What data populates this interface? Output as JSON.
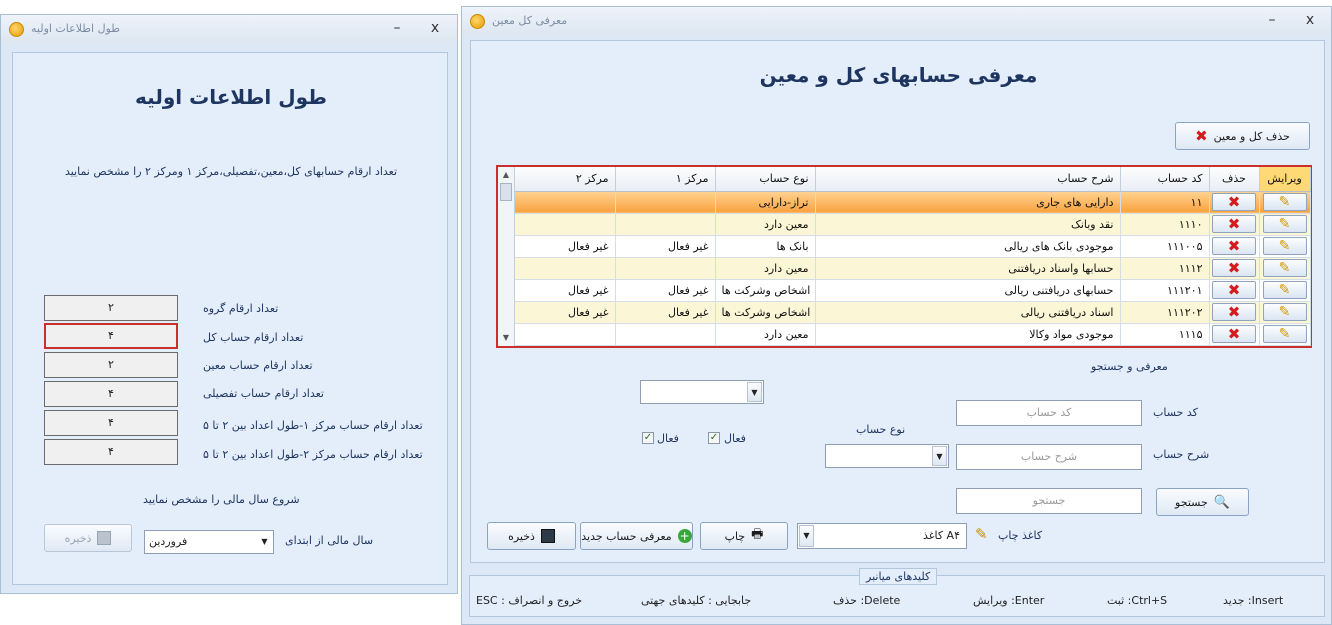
{
  "left_window": {
    "title": "طول اطلاعات اولیه",
    "close": "x",
    "minimize": "–",
    "heading": "طول اطلاعات اولیه",
    "instruction": "تعداد ارقام حسابهای کل،معین،تفصیلی،مرکز ۱ ومرکز ۲ را مشخص نمایید",
    "fields": [
      {
        "label": "تعداد ارقام گروه",
        "value": "۲",
        "selected": false
      },
      {
        "label": "تعداد ارقام حساب کل",
        "value": "۴",
        "selected": true
      },
      {
        "label": "تعداد ارقام حساب معین",
        "value": "۲",
        "selected": false
      },
      {
        "label": "تعداد ارقام حساب تفصیلی",
        "value": "۴",
        "selected": false
      },
      {
        "label": "تعداد ارقام حساب مرکز ۱-طول اعداد بین ۲ تا ۵",
        "value": "۴",
        "selected": false
      },
      {
        "label": "تعداد ارقام حساب مرکز ۲-طول اعداد بین ۲ تا ۵",
        "value": "۴",
        "selected": false
      }
    ],
    "fiscal_heading": "شروع سال مالی را مشخص نمایید",
    "fiscal_label": "سال مالی از ابتدای",
    "fiscal_value": "فروردین",
    "save_label": "ذخیره"
  },
  "main_window": {
    "title": "معرفی کل معین",
    "close": "x",
    "minimize": "–",
    "heading": "معرفی حسابهای کل و معین",
    "delete_all_label": "حذف کل و معین",
    "grid": {
      "columns": [
        "ویرایش",
        "حذف",
        "کد حساب",
        "شرح حساب",
        "نوع حساب",
        "مرکز ۱",
        "مرکز ۲"
      ],
      "rows": [
        {
          "code": "۱۱",
          "desc": "دارایی های جاری",
          "type": "تراز-دارایی",
          "c1": "",
          "c2": "",
          "style": "sel"
        },
        {
          "code": "۱۱۱۰",
          "desc": "نقد وبانک",
          "type": "معین دارد",
          "c1": "",
          "c2": "",
          "style": "alt"
        },
        {
          "code": "۱۱۱۰۰۵",
          "desc": "موجودی بانک های ریالی",
          "type": "بانک ها",
          "c1": "غیر فعال",
          "c2": "غیر فعال",
          "style": ""
        },
        {
          "code": "۱۱۱۲",
          "desc": "حسابها واسناد دریافتنی",
          "type": "معین دارد",
          "c1": "",
          "c2": "",
          "style": "alt"
        },
        {
          "code": "۱۱۱۲۰۱",
          "desc": "حسابهای دریافتنی ریالی",
          "type": "اشخاص وشرکت ها",
          "c1": "غیر فعال",
          "c2": "غیر فعال",
          "style": ""
        },
        {
          "code": "۱۱۱۲۰۲",
          "desc": "اسناد دریافتنی ریالی",
          "type": "اشخاص وشرکت ها",
          "c1": "غیر فعال",
          "c2": "غیر فعال",
          "style": "alt"
        },
        {
          "code": "۱۱۱۵",
          "desc": "موجودی مواد وکالا",
          "type": "معین دارد",
          "c1": "",
          "c2": "",
          "style": ""
        }
      ]
    },
    "search_section": "معرفی و جستجو",
    "code_label": "کد حساب",
    "code_placeholder": "کد حساب",
    "desc_label": "شرح حساب",
    "desc_placeholder": "شرح حساب",
    "search_placeholder": "جستجو",
    "search_button": "جستجو",
    "account_type_label": "نوع حساب",
    "active1_label": "فعال",
    "active2_label": "فعال",
    "print_paper_label": "کاغذ چاپ",
    "print_paper_value": "کاغذ A۴",
    "print_button": "چاپ",
    "new_account_button": "معرفی حساب جدید",
    "save_button": "ذخیره"
  },
  "shortcuts": {
    "caption": "کلیدهای میانبر",
    "new": "جدید :Insert",
    "save": "ثبت :Ctrl+S",
    "edit": "ویرایش :Enter",
    "delete": "حذف :Delete",
    "move": "جابجایی : کلیدهای جهتی",
    "exit": "ESC : خروج و انصراف"
  }
}
